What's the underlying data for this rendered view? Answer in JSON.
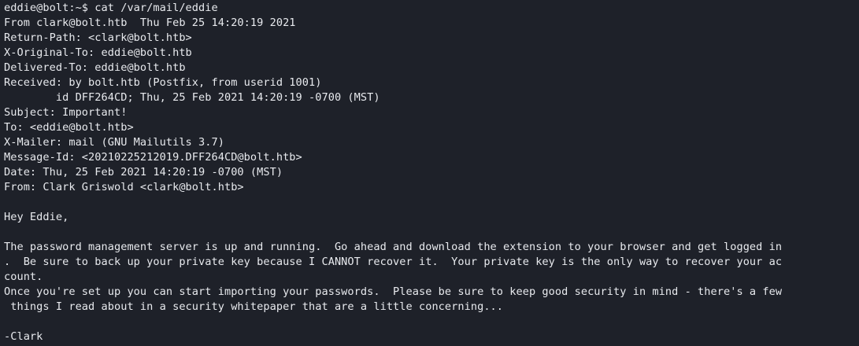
{
  "terminal": {
    "background": "#1e2129",
    "foreground": "#e8eaee",
    "prompt": "eddie@bolt:~$ ",
    "command": "cat /var/mail/eddie",
    "lines": [
      "From clark@bolt.htb  Thu Feb 25 14:20:19 2021",
      "Return-Path: <clark@bolt.htb>",
      "X-Original-To: eddie@bolt.htb",
      "Delivered-To: eddie@bolt.htb",
      "Received: by bolt.htb (Postfix, from userid 1001)",
      "        id DFF264CD; Thu, 25 Feb 2021 14:20:19 -0700 (MST)",
      "Subject: Important!",
      "To: <eddie@bolt.htb>",
      "X-Mailer: mail (GNU Mailutils 3.7)",
      "Message-Id: <20210225212019.DFF264CD@bolt.htb>",
      "Date: Thu, 25 Feb 2021 14:20:19 -0700 (MST)",
      "From: Clark Griswold <clark@bolt.htb>",
      "",
      "Hey Eddie,",
      "",
      "The password management server is up and running.  Go ahead and download the extension to your browser and get logged in",
      ".  Be sure to back up your private key because I CANNOT recover it.  Your private key is the only way to recover your ac",
      "count.",
      "Once you're set up you can start importing your passwords.  Please be sure to keep good security in mind - there's a few",
      " things I read about in a security whitepaper that are a little concerning...",
      "",
      "-Clark"
    ]
  }
}
